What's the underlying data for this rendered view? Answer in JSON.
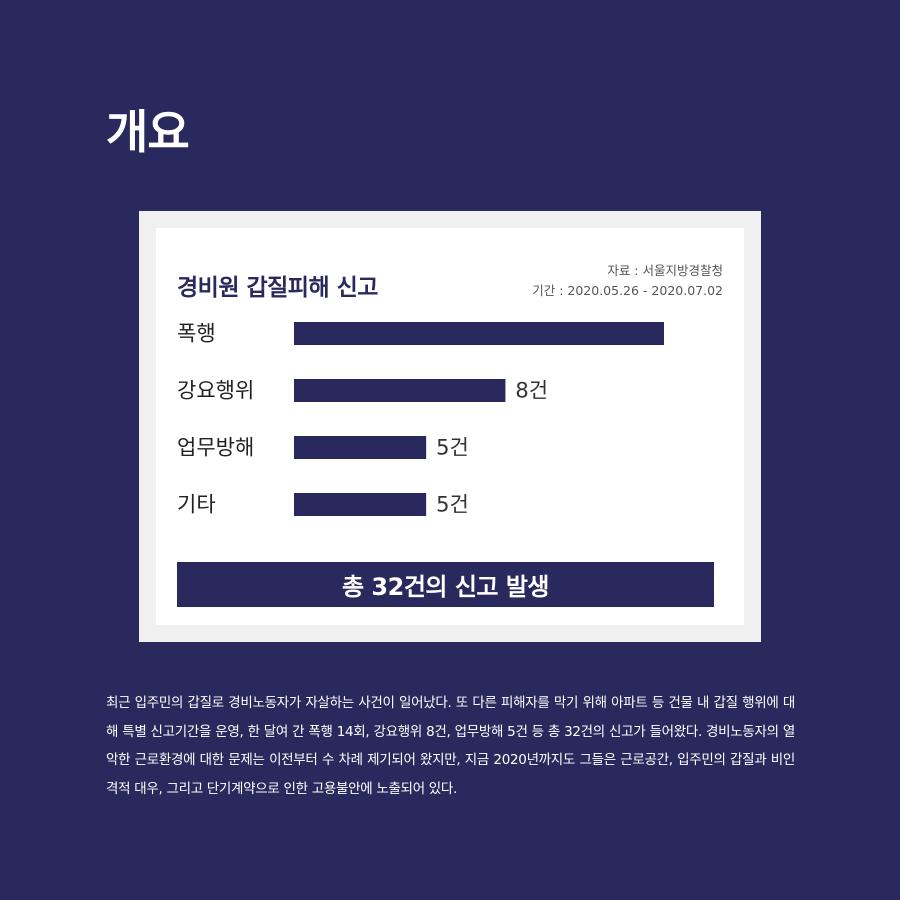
{
  "page": {
    "title": "개요",
    "description": " 최근 입주민의 갑질로 경비노동자가 자살하는 사건이 일어났다. 또 다른 피해자를 막기 위해 아파트 등 건물 내 갑질 행위에 대해 특별 신고기간을 운영, 한 달여 간 폭행 14회, 강요행위 8건, 업무방해 5건 등 총 32건의 신고가 들어왔다. 경비노동자의 열악한 근로환경에 대한 문제는 이전부터 수 차례 제기되어 왔지만, 지금 2020년까지도 그들은 근로공간, 입주민의 갑질과 비인격적 대우, 그리고 단기계약으로 인한 고용불안에 노출되어 있다."
  },
  "colors": {
    "background": "#2a295d",
    "bar": "#2a295d",
    "card": "#ffffff",
    "frame": "#f0f0f1"
  },
  "chart_data": {
    "type": "bar",
    "orientation": "horizontal",
    "title": "경비원 갑질피해 신고",
    "source": "자료 : 서울지방경찰청",
    "period": "기간 : 2020.05.26 - 2020.07.02",
    "categories": [
      "폭행",
      "강요행위",
      "업무방해",
      "기타"
    ],
    "values": [
      14,
      8,
      5,
      5
    ],
    "value_labels": [
      "",
      "8건",
      "5건",
      "5건"
    ],
    "xlim": [
      0,
      14
    ],
    "total_label": "총 32건의 신고 발생"
  }
}
